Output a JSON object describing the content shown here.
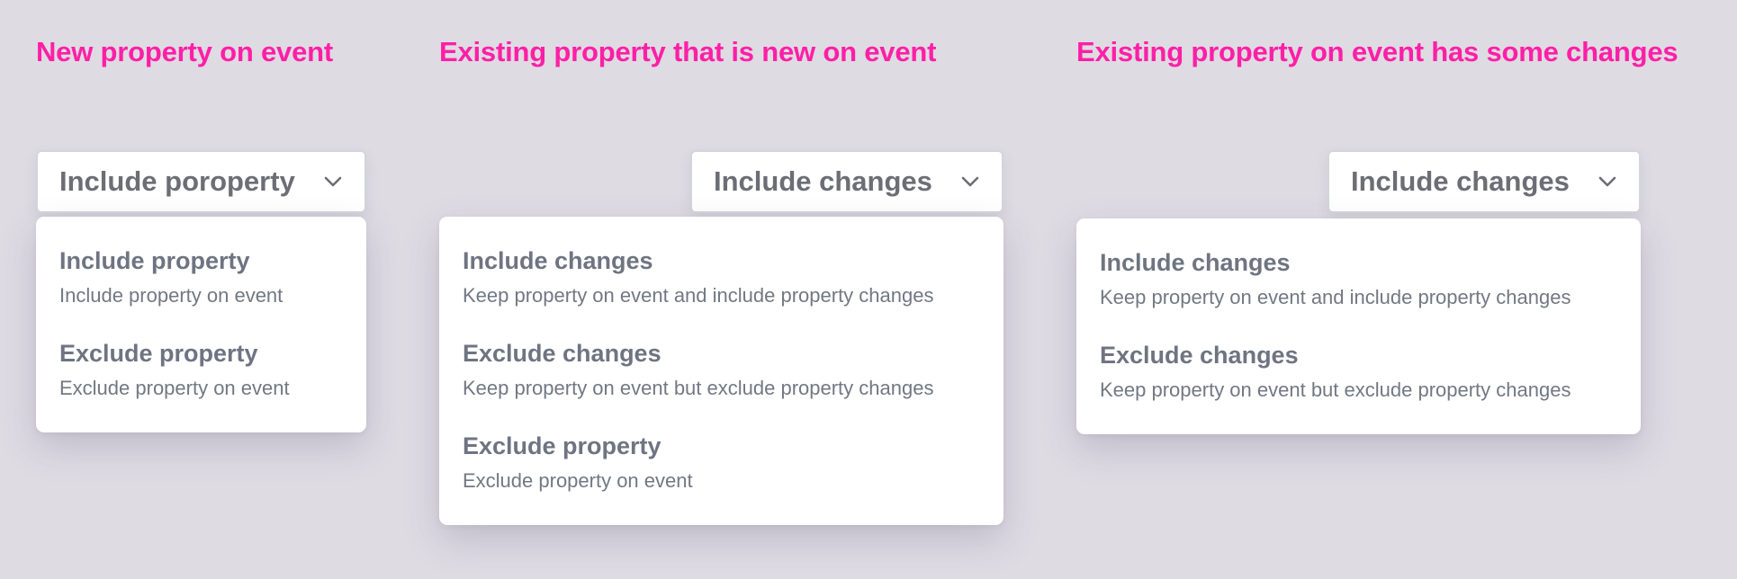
{
  "headings": {
    "new_property": "New property on event",
    "existing_new": "Existing property that is new on event",
    "existing_changes": "Existing property on event has some changes"
  },
  "panels": [
    {
      "select_value": "Include poroperty",
      "options": [
        {
          "title": "Include property",
          "description": "Include property on event"
        },
        {
          "title": "Exclude property",
          "description": "Exclude property on event"
        }
      ]
    },
    {
      "select_value": "Include changes",
      "options": [
        {
          "title": "Include changes",
          "description": "Keep property on event and include property changes"
        },
        {
          "title": "Exclude changes",
          "description": "Keep property on event but exclude property changes"
        },
        {
          "title": "Exclude property",
          "description": "Exclude property on event"
        }
      ]
    },
    {
      "select_value": "Include changes",
      "options": [
        {
          "title": "Include changes",
          "description": "Keep property on event and include property changes"
        },
        {
          "title": "Exclude changes",
          "description": "Keep property on event but exclude property changes"
        }
      ]
    }
  ],
  "icons": {
    "select_chevron": "chevron-down-icon"
  },
  "colors": {
    "background": "#dedbe3",
    "heading_accent": "#ff1fa6",
    "option_title": "#6e7481",
    "option_desc": "#727883"
  }
}
